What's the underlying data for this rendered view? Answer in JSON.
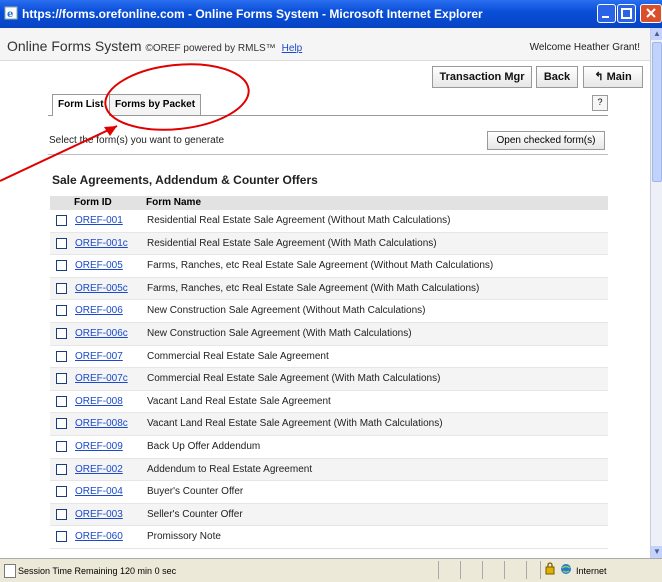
{
  "window": {
    "title": "https://forms.orefonline.com - Online Forms System - Microsoft Internet Explorer"
  },
  "header": {
    "app_name": "Online Forms System",
    "subtitle": "©OREF powered by RMLS™",
    "help_label": "Help",
    "welcome": "Welcome Heather Grant!"
  },
  "toolbar": {
    "transaction_label": "Transaction Mgr",
    "back_label": "Back",
    "main_label": "Main",
    "main_icon": "return-arrow-icon"
  },
  "tabs": [
    {
      "label": "Form List",
      "active": true
    },
    {
      "label": "Forms by Packet",
      "active": false
    }
  ],
  "help_button": "?",
  "instruction": "Select the form(s) you want to generate",
  "open_button": "Open checked form(s)",
  "section": {
    "title": "Sale Agreements, Addendum & Counter Offers"
  },
  "table": {
    "headers": [
      "Form ID",
      "Form Name"
    ],
    "rows": [
      {
        "id": "OREF-001",
        "name": "Residential Real Estate Sale Agreement (Without Math Calculations)"
      },
      {
        "id": "OREF-001c",
        "name": "Residential Real Estate Sale Agreement (With Math Calculations)"
      },
      {
        "id": "OREF-005",
        "name": "Farms, Ranches, etc Real Estate Sale Agreement (Without Math Calculations)"
      },
      {
        "id": "OREF-005c",
        "name": "Farms, Ranches, etc Real Estate Sale Agreement (With Math Calculations)"
      },
      {
        "id": "OREF-006",
        "name": "New Construction Sale Agreement (Without Math Calculations)"
      },
      {
        "id": "OREF-006c",
        "name": "New Construction Sale Agreement (With Math Calculations)"
      },
      {
        "id": "OREF-007",
        "name": "Commercial Real Estate Sale Agreement"
      },
      {
        "id": "OREF-007c",
        "name": "Commercial Real Estate Sale Agreement (With Math Calculations)"
      },
      {
        "id": "OREF-008",
        "name": "Vacant Land Real Estate Sale Agreement"
      },
      {
        "id": "OREF-008c",
        "name": "Vacant Land Real Estate Sale Agreement (With Math Calculations)"
      },
      {
        "id": "OREF-009",
        "name": "Back Up Offer Addendum"
      },
      {
        "id": "OREF-002",
        "name": "Addendum to Real Estate Agreement"
      },
      {
        "id": "OREF-004",
        "name": "Buyer's Counter Offer"
      },
      {
        "id": "OREF-003",
        "name": "Seller's Counter Offer"
      },
      {
        "id": "OREF-060",
        "name": "Promissory Note"
      }
    ]
  },
  "status": {
    "text": "Session Time Remaining 120 min 0 sec",
    "zone": "Internet"
  },
  "colors": {
    "titlebar": "#0a4fd8",
    "link": "#1a4acb",
    "annotation": "#e00000"
  }
}
